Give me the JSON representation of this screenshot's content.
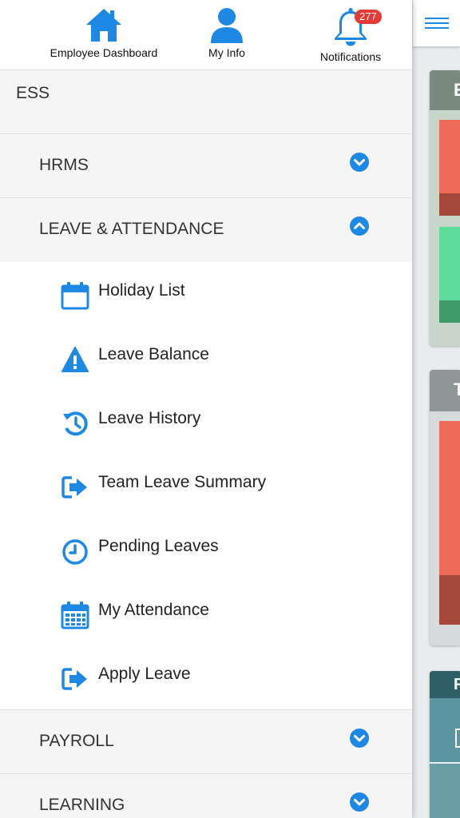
{
  "topbar": {
    "dashboard_label": "Employee Dashboard",
    "myinfo_label": "My Info",
    "notifications_label": "Notifications",
    "notifications_count": "277"
  },
  "menu": {
    "ess_label": "ESS",
    "hrms_label": "HRMS",
    "leave_label": "LEAVE & ATTENDANCE",
    "payroll_label": "PAYROLL",
    "learning_label": "LEARNING",
    "leave_items": [
      {
        "label": "Holiday List",
        "icon": "calendar-icon"
      },
      {
        "label": "Leave Balance",
        "icon": "warning-icon"
      },
      {
        "label": "Leave History",
        "icon": "history-icon"
      },
      {
        "label": "Team Leave Summary",
        "icon": "sign-out-icon"
      },
      {
        "label": "Pending Leaves",
        "icon": "clock-icon"
      },
      {
        "label": "My Attendance",
        "icon": "calendar-grid-icon"
      },
      {
        "label": "Apply Leave",
        "icon": "sign-out-icon"
      }
    ]
  },
  "background": {
    "card1_title_initial": "E",
    "card2_title_initial": "T",
    "card3_title_initial": "F"
  },
  "colors": {
    "accent": "#1e88e5",
    "badge": "#e53935",
    "tile_red": "#ee6a59",
    "tile_green": "#5fdc9b"
  }
}
